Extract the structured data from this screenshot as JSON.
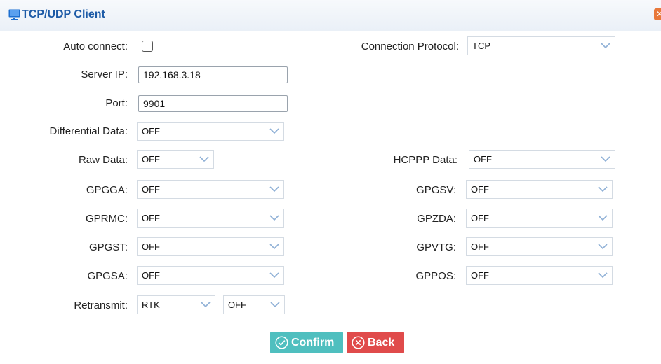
{
  "window": {
    "title": "TCP/UDP Client",
    "icon": "monitor-icon",
    "close_icon": "close-icon"
  },
  "form": {
    "auto_connect": {
      "label": "Auto connect:",
      "checked": false
    },
    "connection_protocol": {
      "label": "Connection Protocol:",
      "value": "TCP"
    },
    "server_ip": {
      "label": "Server IP:",
      "value": "192.168.3.18"
    },
    "port": {
      "label": "Port:",
      "value": "9901"
    },
    "differential_data": {
      "label": "Differential Data:",
      "value": "OFF"
    },
    "raw_data": {
      "label": "Raw Data:",
      "value": "OFF"
    },
    "hcppp_data": {
      "label": "HCPPP Data:",
      "value": "OFF"
    },
    "gpgga": {
      "label": "GPGGA:",
      "value": "OFF"
    },
    "gprmc": {
      "label": "GPRMC:",
      "value": "OFF"
    },
    "gpgst": {
      "label": "GPGST:",
      "value": "OFF"
    },
    "gpgsa": {
      "label": "GPGSA:",
      "value": "OFF"
    },
    "gpgsv": {
      "label": "GPGSV:",
      "value": "OFF"
    },
    "gpzda": {
      "label": "GPZDA:",
      "value": "OFF"
    },
    "gpvtg": {
      "label": "GPVTG:",
      "value": "OFF"
    },
    "gppos": {
      "label": "GPPOS:",
      "value": "OFF"
    },
    "retransmit": {
      "label": "Retransmit:",
      "value1": "RTK",
      "value2": "OFF"
    }
  },
  "buttons": {
    "confirm": "Confirm",
    "back": "Back"
  },
  "colors": {
    "title": "#1c5aa6",
    "header_bg": "#eaf0f7",
    "confirm_bg": "#4fbfbf",
    "back_bg": "#e04b4b",
    "chevron": "#8fb0d6"
  }
}
